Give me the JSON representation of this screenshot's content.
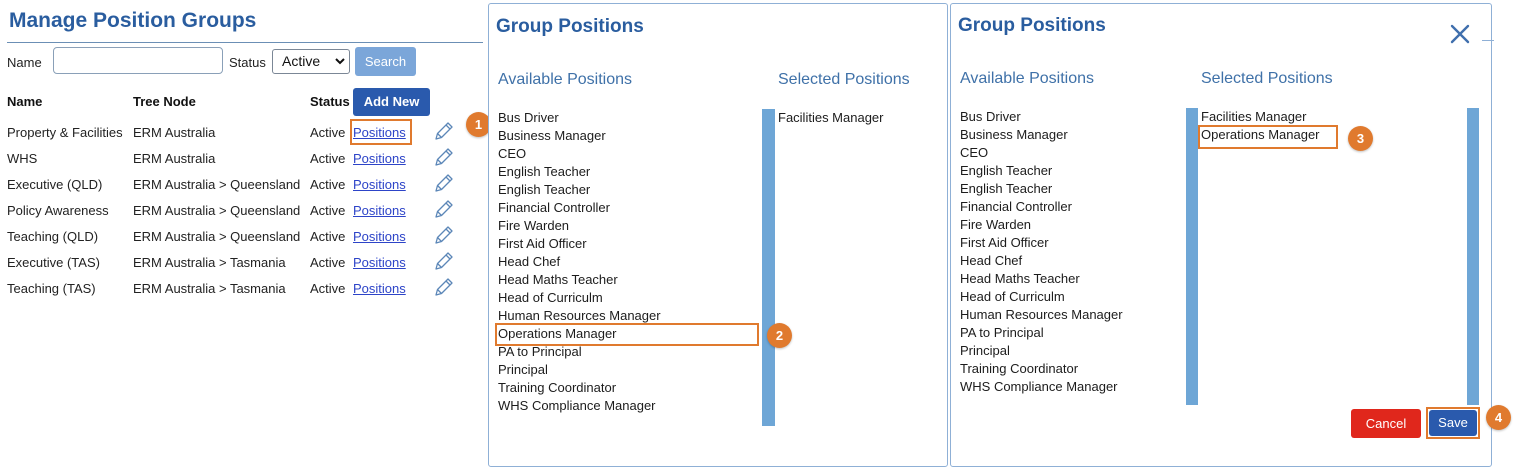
{
  "manage": {
    "title": "Manage Position Groups",
    "name_label": "Name",
    "name_value": "",
    "status_label": "Status",
    "status_selected": "Active",
    "search_label": "Search",
    "add_new_label": "Add New",
    "columns": [
      "Name",
      "Tree Node",
      "Status"
    ],
    "rows": [
      {
        "name": "Property & Facilities",
        "tree_node": "ERM Australia",
        "status": "Active",
        "link": "Positions"
      },
      {
        "name": "WHS",
        "tree_node": "ERM Australia",
        "status": "Active",
        "link": "Positions"
      },
      {
        "name": "Executive (QLD)",
        "tree_node": "ERM Australia > Queensland",
        "status": "Active",
        "link": "Positions"
      },
      {
        "name": "Policy Awareness",
        "tree_node": "ERM Australia > Queensland",
        "status": "Active",
        "link": "Positions"
      },
      {
        "name": "Teaching (QLD)",
        "tree_node": "ERM Australia > Queensland",
        "status": "Active",
        "link": "Positions"
      },
      {
        "name": "Executive (TAS)",
        "tree_node": "ERM Australia > Tasmania",
        "status": "Active",
        "link": "Positions"
      },
      {
        "name": "Teaching (TAS)",
        "tree_node": "ERM Australia > Tasmania",
        "status": "Active",
        "link": "Positions"
      }
    ]
  },
  "panel1": {
    "title": "Group Positions",
    "available_heading": "Available Positions",
    "selected_heading": "Selected Positions",
    "available": [
      "Bus Driver",
      "Business Manager",
      "CEO",
      "English Teacher",
      "English Teacher",
      "Financial Controller",
      "Fire Warden",
      "First Aid Officer",
      "Head Chef",
      "Head Maths Teacher",
      "Head of Curriculm",
      "Human Resources Manager",
      "Operations Manager",
      "PA to Principal",
      "Principal",
      "Training Coordinator",
      "WHS Compliance Manager"
    ],
    "selected": [
      "Facilities Manager"
    ]
  },
  "panel2": {
    "title": "Group Positions",
    "available_heading": "Available Positions",
    "selected_heading": "Selected Positions",
    "available": [
      "Bus Driver",
      "Business Manager",
      "CEO",
      "English Teacher",
      "English Teacher",
      "Financial Controller",
      "Fire Warden",
      "First Aid Officer",
      "Head Chef",
      "Head Maths Teacher",
      "Head of Curriculm",
      "Human Resources Manager",
      "PA to Principal",
      "Principal",
      "Training Coordinator",
      "WHS Compliance Manager"
    ],
    "selected": [
      "Facilities Manager",
      "Operations Manager"
    ],
    "cancel_label": "Cancel",
    "save_label": "Save"
  },
  "callouts": [
    "1",
    "2",
    "3",
    "4"
  ],
  "icons": {
    "edit": "pencil-icon",
    "close": "close-icon",
    "dropdown": "chevron-down-icon"
  },
  "colors": {
    "accent": "#2a5d9f",
    "primary_button": "#2a5aad",
    "danger_button": "#e0271c",
    "callout": "#e07a2e",
    "list_bar": "#6ea6d6"
  }
}
